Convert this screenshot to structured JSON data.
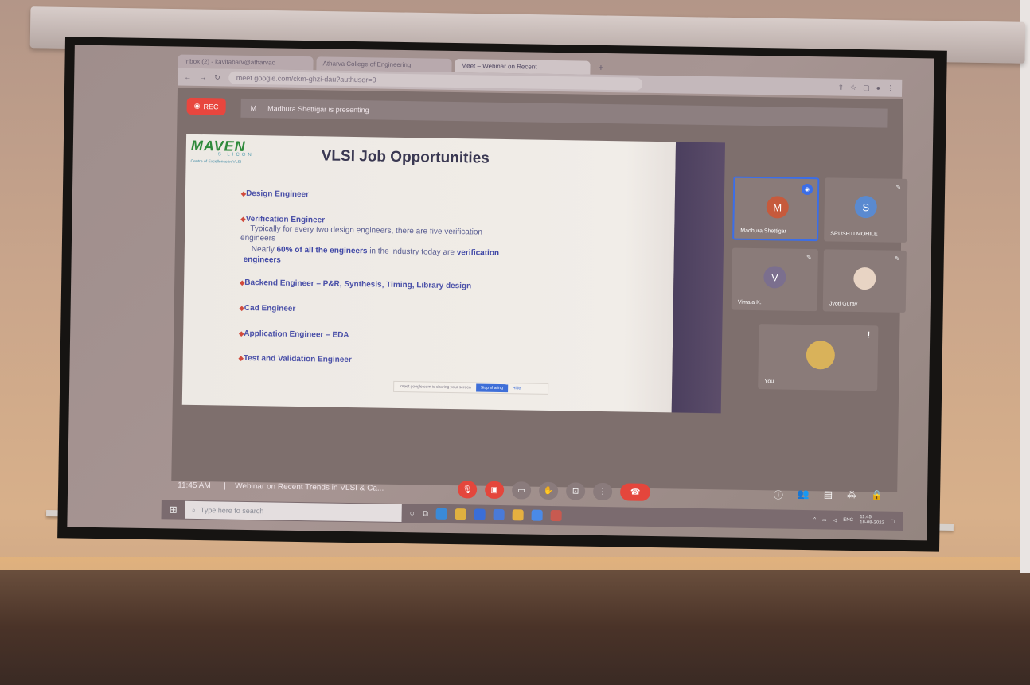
{
  "browser": {
    "tabs": [
      "Inbox (2) - kavitabarv@atharvac",
      "Atharva College of Engineering",
      "Meet – Webinar on Recent"
    ],
    "new_tab": "+",
    "url": "meet.google.com/ckm-ghzi-dau?authuser=0"
  },
  "meet": {
    "rec_label": "REC",
    "presenter_initial": "M",
    "presenting_text": "Madhura Shettigar is presenting",
    "time": "11:45 AM",
    "separator": "|",
    "meeting_title": "Webinar on Recent Trends in VLSI & Ca...",
    "participants": [
      {
        "initial": "M",
        "name": "Madhura Shettigar",
        "color": "#c65a3c"
      },
      {
        "initial": "S",
        "name": "SRUSHTI MOHILE",
        "color": "#5a8ad0"
      },
      {
        "initial": "V",
        "name": "Vimala K.",
        "color": "#7b6f8e"
      },
      {
        "initial": "",
        "name": "Jyoti Gurav",
        "color": "#e8d4c4"
      },
      {
        "initial": "",
        "name": "You",
        "color": "#d9b25a"
      }
    ],
    "alert": "!"
  },
  "slide": {
    "logo": "MAVEN",
    "logo_sub": "SILICON",
    "logo_tag": "Centre of Excellence in VLSI",
    "title": "VLSI Job Opportunities",
    "bullets": [
      "Design Engineer",
      "Verification Engineer",
      "Backend Engineer – P&R, Synthesis, Timing, Library design",
      "Cad Engineer",
      "Application Engineer – EDA",
      "Test and Validation Engineer"
    ],
    "line1": "Typically for every two design engineers, there are five verification",
    "line2": "engineers",
    "line3_pre": "Nearly ",
    "line3_bold": "60% of all the engineers",
    "line3_mid": " in the industry today are ",
    "line3_bold2": "verification",
    "line4": "engineers",
    "share_text": "meet.google.com is sharing your screen",
    "share_button": "Stop sharing",
    "share_hide": "Hide"
  },
  "taskbar": {
    "search_placeholder": "Type here to search",
    "lang": "ENG",
    "clock_time": "11:45",
    "clock_date": "18-08-2022"
  }
}
